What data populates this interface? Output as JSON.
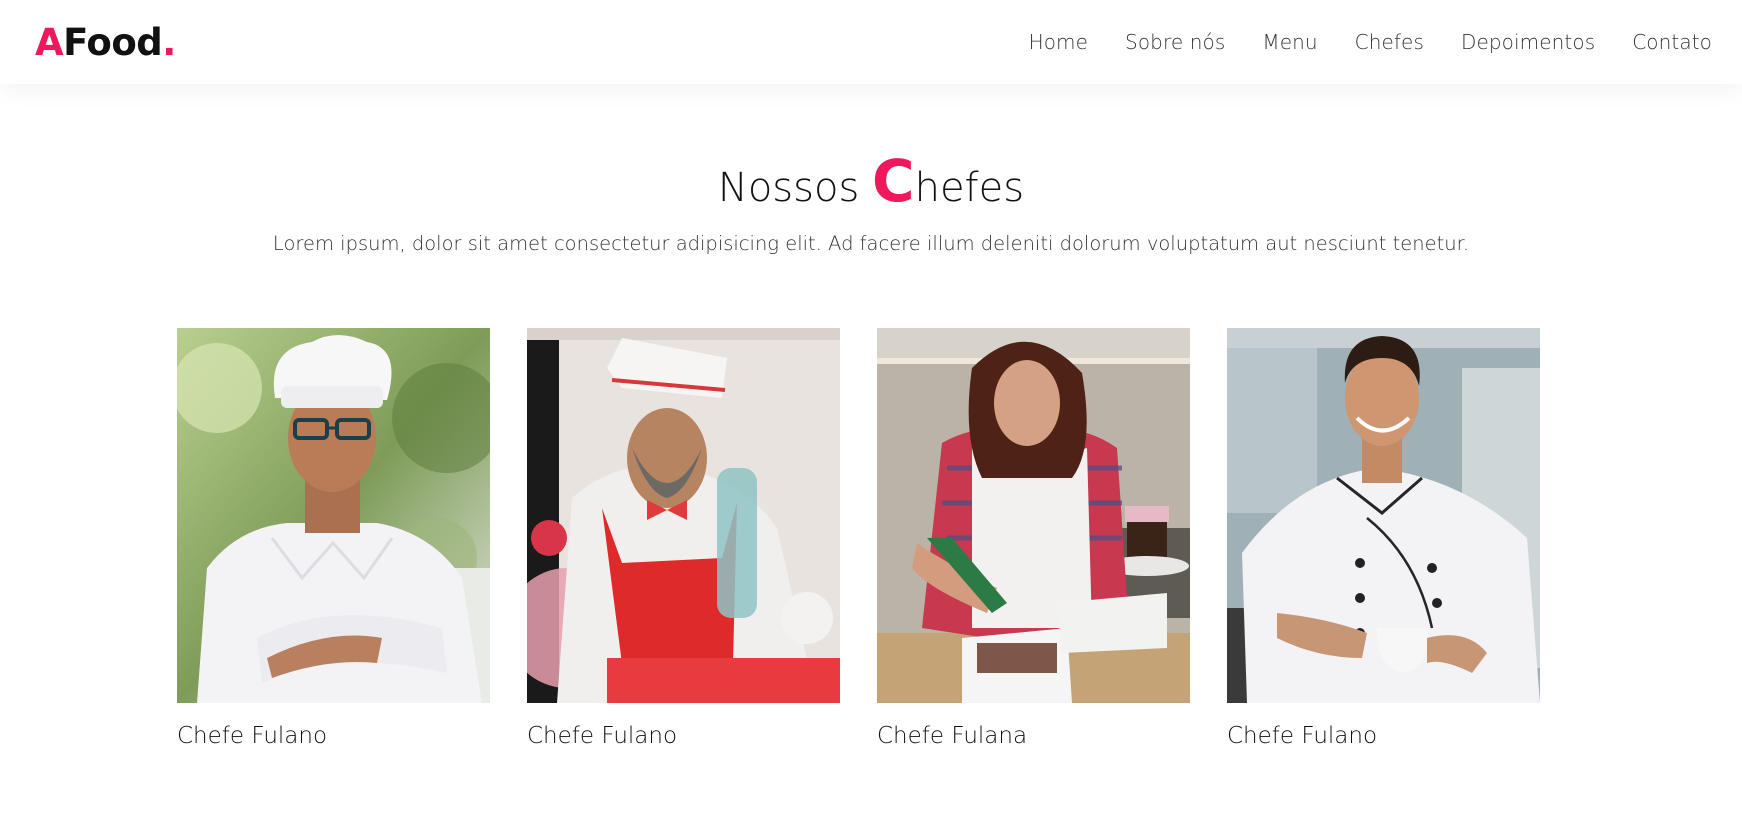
{
  "brand": {
    "letter": "A",
    "rest": "Food",
    "dot": "."
  },
  "nav": {
    "items": [
      "Home",
      "Sobre nós",
      "Menu",
      "Chefes",
      "Depoimentos",
      "Contato"
    ]
  },
  "section": {
    "title_prefix": "Nossos ",
    "title_big_letter": "C",
    "title_suffix": "hefes",
    "subtitle": "Lorem ipsum, dolor sit amet consectetur adipisicing elit. Ad facere illum deleniti dolorum voluptatum aut nesciunt tenetur."
  },
  "chefs": [
    {
      "name": "Chefe Fulano"
    },
    {
      "name": "Chefe Fulano"
    },
    {
      "name": "Chefe Fulana"
    },
    {
      "name": "Chefe Fulano"
    }
  ],
  "colors": {
    "accent": "#f0185a",
    "text": "#111111"
  }
}
